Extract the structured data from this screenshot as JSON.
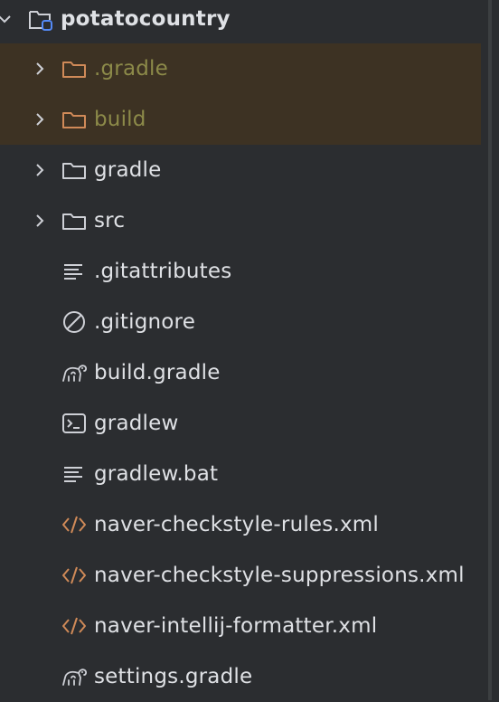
{
  "project": {
    "name": "potatocountry",
    "icon": "project-folder-icon",
    "expanded": true
  },
  "items": [
    {
      "label": ".gradle",
      "type": "folder",
      "icon": "folder-icon",
      "excluded": true,
      "expandable": true
    },
    {
      "label": "build",
      "type": "folder",
      "icon": "folder-icon",
      "excluded": true,
      "expandable": true
    },
    {
      "label": "gradle",
      "type": "folder",
      "icon": "folder-icon",
      "excluded": false,
      "expandable": true
    },
    {
      "label": "src",
      "type": "folder",
      "icon": "folder-icon",
      "excluded": false,
      "expandable": true
    },
    {
      "label": ".gitattributes",
      "type": "file",
      "icon": "text-file-icon"
    },
    {
      "label": ".gitignore",
      "type": "file",
      "icon": "ignore-file-icon"
    },
    {
      "label": "build.gradle",
      "type": "file",
      "icon": "gradle-elephant-icon"
    },
    {
      "label": "gradlew",
      "type": "file",
      "icon": "terminal-script-icon"
    },
    {
      "label": "gradlew.bat",
      "type": "file",
      "icon": "text-file-icon"
    },
    {
      "label": "naver-checkstyle-rules.xml",
      "type": "file",
      "icon": "xml-file-icon"
    },
    {
      "label": "naver-checkstyle-suppressions.xml",
      "type": "file",
      "icon": "xml-file-icon"
    },
    {
      "label": "naver-intellij-formatter.xml",
      "type": "file",
      "icon": "xml-file-icon"
    },
    {
      "label": "settings.gradle",
      "type": "file",
      "icon": "gradle-elephant-icon"
    }
  ],
  "colors": {
    "background": "#2b2d30",
    "excluded_row_bg": "#3d3223",
    "excluded_text": "#8c8a49",
    "excluded_folder": "#d08a58",
    "text": "#dfe1e5",
    "icon_gray": "#ced0d6",
    "xml_orange": "#d08a58",
    "project_blue": "#548af7"
  }
}
